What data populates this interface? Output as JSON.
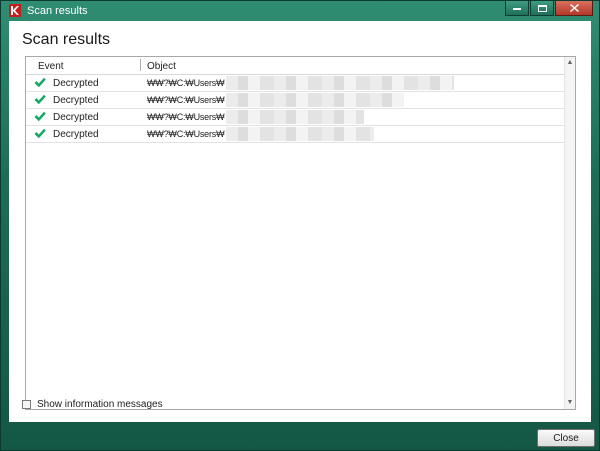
{
  "window": {
    "title": "Scan results",
    "accent_color": "#1d6d56"
  },
  "page": {
    "heading": "Scan results"
  },
  "table": {
    "columns": [
      "Event",
      "Object"
    ],
    "rows": [
      {
        "event": "Decrypted",
        "object": "₩₩?₩C:₩Users₩"
      },
      {
        "event": "Decrypted",
        "object": "₩₩?₩C:₩Users₩"
      },
      {
        "event": "Decrypted",
        "object": "₩₩?₩C:₩Users₩"
      },
      {
        "event": "Decrypted",
        "object": "₩₩?₩C:₩Users₩"
      }
    ]
  },
  "options": {
    "show_info_label": "Show information messages",
    "show_info_checked": false
  },
  "footer": {
    "close_label": "Close"
  }
}
